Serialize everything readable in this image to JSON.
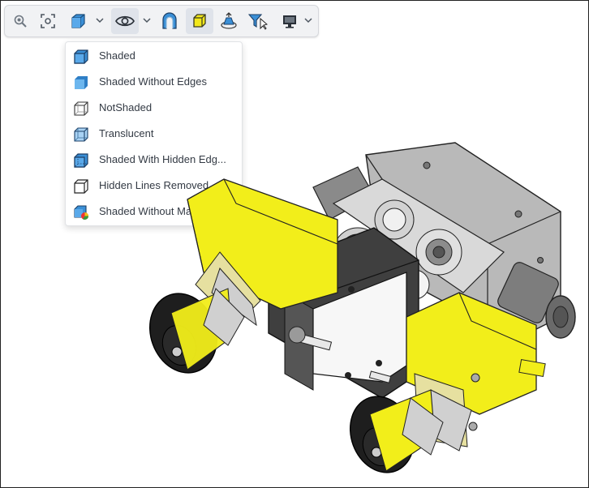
{
  "toolbar": {
    "buttons": [
      {
        "name": "zoom-icon"
      },
      {
        "name": "fit-view-icon"
      },
      {
        "name": "view-cube-icon"
      },
      {
        "name": "visibility-eye-icon"
      },
      {
        "name": "material-icon"
      },
      {
        "name": "box-select-icon"
      },
      {
        "name": "explode-icon"
      },
      {
        "name": "filter-icon"
      },
      {
        "name": "monitor-icon"
      }
    ]
  },
  "display_menu": {
    "items": [
      {
        "label": "Shaded",
        "icon": "shaded-icon"
      },
      {
        "label": "Shaded Without Edges",
        "icon": "shaded-without-edges-icon"
      },
      {
        "label": "NotShaded",
        "icon": "not-shaded-icon"
      },
      {
        "label": "Translucent",
        "icon": "translucent-icon"
      },
      {
        "label": "Shaded With Hidden Edg...",
        "icon": "shaded-hidden-edges-icon"
      },
      {
        "label": "Hidden Lines Removed",
        "icon": "hidden-lines-removed-icon"
      },
      {
        "label": "Shaded Without Materials",
        "icon": "shaded-without-materials-icon"
      }
    ]
  },
  "colors": {
    "toolbar_bg": "#f1f2f4",
    "accent_blue": "#3a8fd6",
    "model_yellow": "#f2ee1a",
    "model_gray": "#8d8d8d"
  }
}
